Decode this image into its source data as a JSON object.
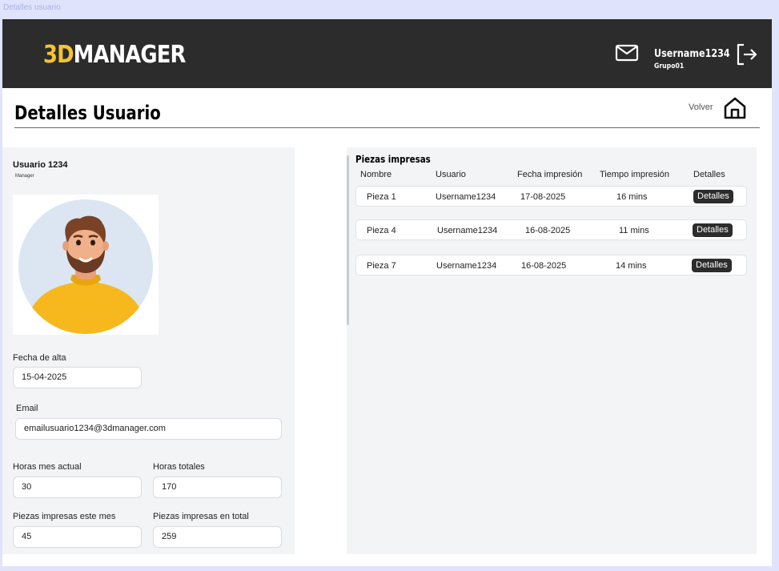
{
  "frame_label": "Detalles usuario",
  "header": {
    "logo_accent": "3D",
    "logo_rest": "MANAGER",
    "username": "Username1234",
    "group": "Grupo01",
    "icons": {
      "mail": "mail-icon",
      "logout": "logout-icon"
    },
    "colors": {
      "bar": "#2c2c2c",
      "accent": "#f4c430"
    }
  },
  "page": {
    "title": "Detalles Usuario",
    "back_label": "Volver",
    "home_icon": "home-icon"
  },
  "profile": {
    "name": "Usuario 1234",
    "role": "Manager",
    "avatar_icon": "avatar-illustration",
    "fields": {
      "alta_label": "Fecha de alta",
      "alta_value": "15-04-2025",
      "email_label": "Email",
      "email_value": "emailusuario1234@3dmanager.com",
      "horas_mes_label": "Horas mes actual",
      "horas_mes_value": "30",
      "horas_totales_label": "Horas totales",
      "horas_totales_value": "170",
      "piezas_mes_label": "Piezas impresas este mes",
      "piezas_mes_value": "45",
      "piezas_total_label": "Piezas impresas en total",
      "piezas_total_value": "259"
    }
  },
  "pieces": {
    "title": "Piezas impresas",
    "columns": [
      "Nombre",
      "Usuario",
      "Fecha impresión",
      "Tiempo impresión",
      "Detalles"
    ],
    "rows": [
      {
        "nombre": "Pieza 1",
        "usuario": "Username1234",
        "fecha": "17-08-2025",
        "tiempo": "16 mins",
        "detalles": "Detalles"
      },
      {
        "nombre": "Pieza 4",
        "usuario": "Username1234",
        "fecha": "16-08-2025",
        "tiempo": "11 mins",
        "detalles": "Detalles"
      },
      {
        "nombre": "Pieza 7",
        "usuario": "Username1234",
        "fecha": "16-08-2025",
        "tiempo": "14 mins",
        "detalles": "Detalles"
      }
    ]
  }
}
